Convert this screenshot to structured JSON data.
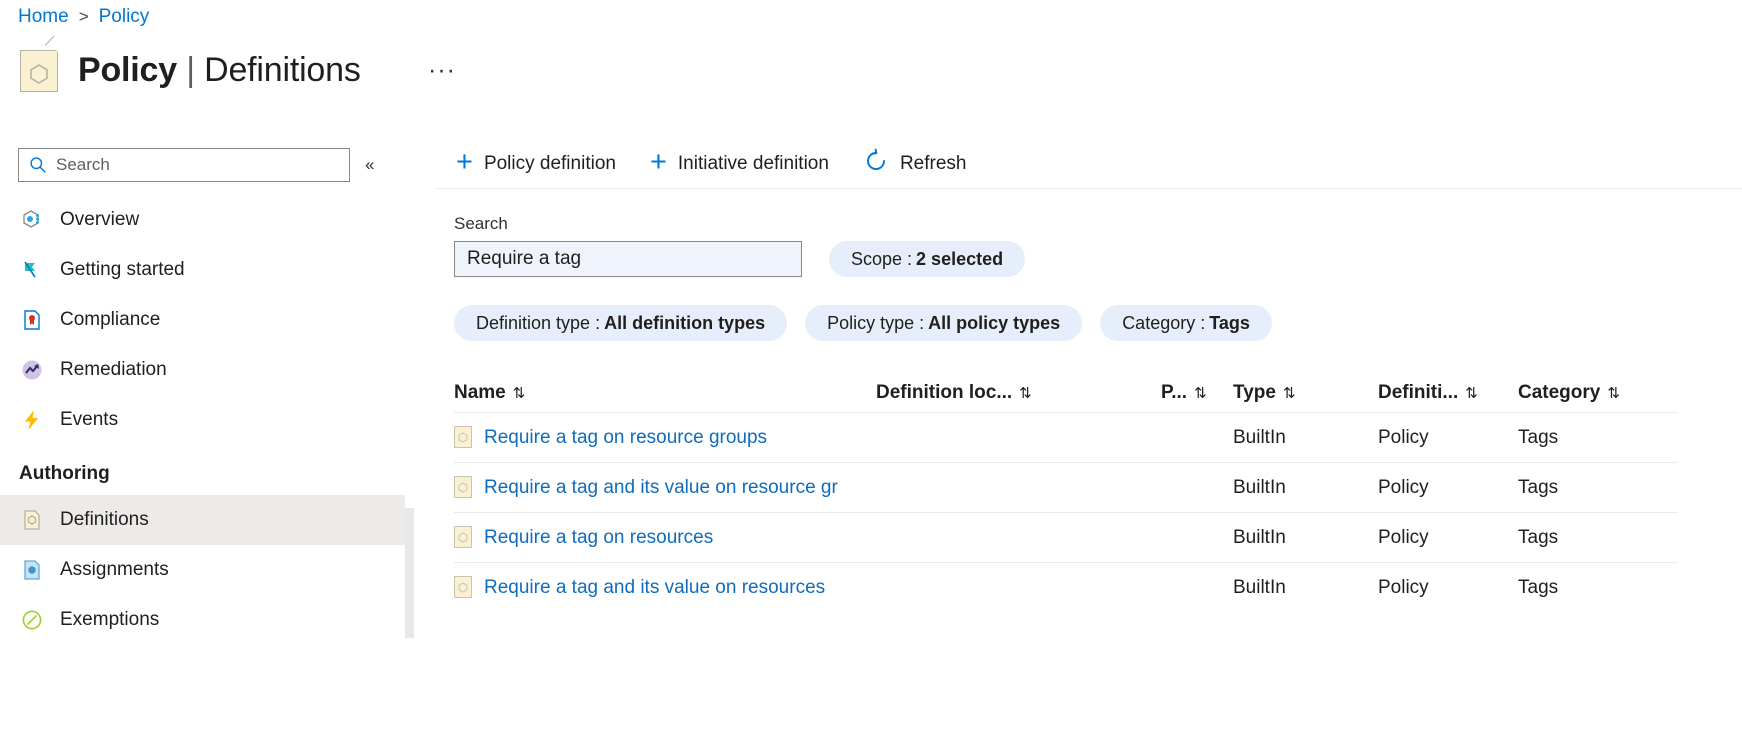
{
  "breadcrumb": {
    "home": "Home",
    "current": "Policy",
    "separator": ">"
  },
  "header": {
    "title_bold": "Policy",
    "title_bar": "|",
    "title_rest": "Definitions",
    "more_label": "···",
    "icon": "policy-document-icon"
  },
  "sidebar": {
    "search_placeholder": "Search",
    "collapse_label": "«",
    "items": [
      {
        "label": "Overview",
        "icon": "overview-icon",
        "selected": false
      },
      {
        "label": "Getting started",
        "icon": "flag-icon",
        "selected": false
      },
      {
        "label": "Compliance",
        "icon": "compliance-document-icon",
        "selected": false
      },
      {
        "label": "Remediation",
        "icon": "remediation-chart-icon",
        "selected": false
      },
      {
        "label": "Events",
        "icon": "lightning-bolt-icon",
        "selected": false
      }
    ],
    "group_header": "Authoring",
    "authoring_items": [
      {
        "label": "Definitions",
        "icon": "definitions-document-icon",
        "selected": true
      },
      {
        "label": "Assignments",
        "icon": "assignments-document-icon",
        "selected": false
      },
      {
        "label": "Exemptions",
        "icon": "exemptions-circle-icon",
        "selected": false
      }
    ]
  },
  "commandbar": {
    "buttons": [
      {
        "label": "Policy definition",
        "icon": "plus-icon"
      },
      {
        "label": "Initiative definition",
        "icon": "plus-icon"
      },
      {
        "label": "Refresh",
        "icon": "refresh-icon"
      }
    ]
  },
  "filters": {
    "search_label": "Search",
    "search_value": "Require a tag",
    "search_placeholder": "Search",
    "scope": {
      "label": "Scope :",
      "value": "2 selected"
    },
    "definition_type": {
      "label": "Definition type :",
      "value": "All definition types"
    },
    "policy_type": {
      "label": "Policy type :",
      "value": "All policy types"
    },
    "category": {
      "label": "Category :",
      "value": "Tags"
    }
  },
  "table": {
    "columns": [
      {
        "label": "Name",
        "sort": "⇅"
      },
      {
        "label": "Definition loc...",
        "sort": "⇅"
      },
      {
        "label": "P...",
        "sort": "⇅"
      },
      {
        "label": "Type",
        "sort": "⇅"
      },
      {
        "label": "Definiti...",
        "sort": "⇅"
      },
      {
        "label": "Category",
        "sort": "⇅"
      }
    ],
    "rows": [
      {
        "name": "Require a tag on resource groups",
        "definition_location": "",
        "p": "",
        "type": "BuiltIn",
        "definition_type": "Policy",
        "category": "Tags"
      },
      {
        "name": "Require a tag and its value on resource gr",
        "definition_location": "",
        "p": "",
        "type": "BuiltIn",
        "definition_type": "Policy",
        "category": "Tags"
      },
      {
        "name": "Require a tag on resources",
        "definition_location": "",
        "p": "",
        "type": "BuiltIn",
        "definition_type": "Policy",
        "category": "Tags"
      },
      {
        "name": "Require a tag and its value on resources",
        "definition_location": "",
        "p": "",
        "type": "BuiltIn",
        "definition_type": "Policy",
        "category": "Tags"
      }
    ]
  },
  "colors": {
    "link": "#0f6cbd",
    "breadcrumb_link": "#0078d4",
    "pill_bg": "#e5eefa",
    "search_bg": "#eff3fb",
    "selected_nav": "#edebe9"
  }
}
